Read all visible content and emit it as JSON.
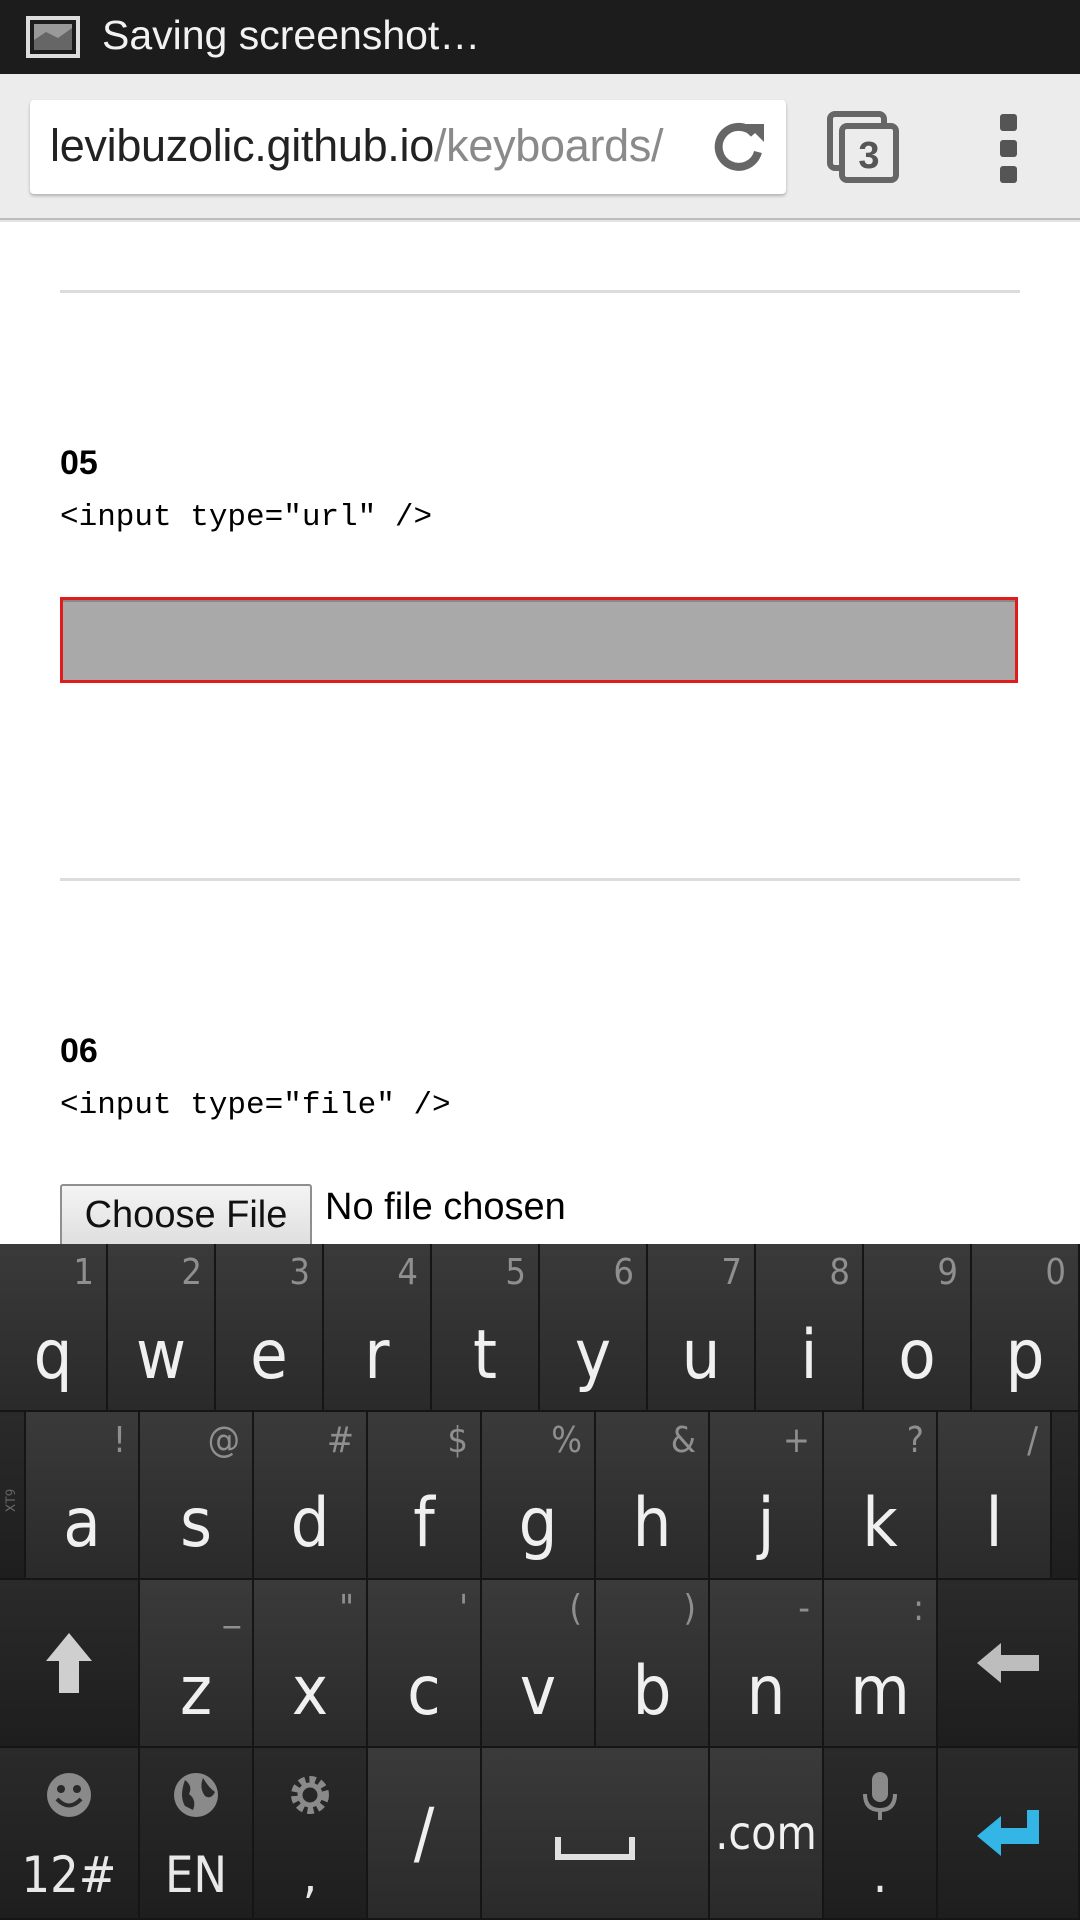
{
  "status_bar": {
    "notification_text": "Saving screenshot…"
  },
  "browser": {
    "url_host": "levibuzolic.github.io",
    "url_path": "/keyboards/",
    "tab_count": "3"
  },
  "sections": [
    {
      "number": "05",
      "code": "<input type=\"url\" />"
    },
    {
      "number": "06",
      "code": "<input type=\"file\" />"
    }
  ],
  "url_input": {
    "value": ""
  },
  "file_input": {
    "button_label": "Choose File",
    "status": "No file chosen"
  },
  "keyboard": {
    "row1": [
      {
        "key": "q",
        "hint": "1"
      },
      {
        "key": "w",
        "hint": "2"
      },
      {
        "key": "e",
        "hint": "3"
      },
      {
        "key": "r",
        "hint": "4"
      },
      {
        "key": "t",
        "hint": "5"
      },
      {
        "key": "y",
        "hint": "6"
      },
      {
        "key": "u",
        "hint": "7"
      },
      {
        "key": "i",
        "hint": "8"
      },
      {
        "key": "o",
        "hint": "9"
      },
      {
        "key": "p",
        "hint": "0"
      }
    ],
    "row2": [
      {
        "key": "a",
        "hint": "!"
      },
      {
        "key": "s",
        "hint": "@"
      },
      {
        "key": "d",
        "hint": "#"
      },
      {
        "key": "f",
        "hint": "$"
      },
      {
        "key": "g",
        "hint": "%"
      },
      {
        "key": "h",
        "hint": "&"
      },
      {
        "key": "j",
        "hint": "+"
      },
      {
        "key": "k",
        "hint": "?"
      },
      {
        "key": "l",
        "hint": "/"
      }
    ],
    "row3": [
      {
        "key": "z",
        "hint": "_"
      },
      {
        "key": "x",
        "hint": "\""
      },
      {
        "key": "c",
        "hint": "'"
      },
      {
        "key": "v",
        "hint": "("
      },
      {
        "key": "b",
        "hint": ")"
      },
      {
        "key": "n",
        "hint": "-"
      },
      {
        "key": "m",
        "hint": ":"
      }
    ],
    "row4": {
      "symbols_label": "12#",
      "language_label": "EN",
      "settings_sub": ",",
      "slash_label": "/",
      "dotcom_label": ".com",
      "mic_sub": "."
    },
    "side_label": "XT9",
    "enter_color": "#33b5e5"
  }
}
